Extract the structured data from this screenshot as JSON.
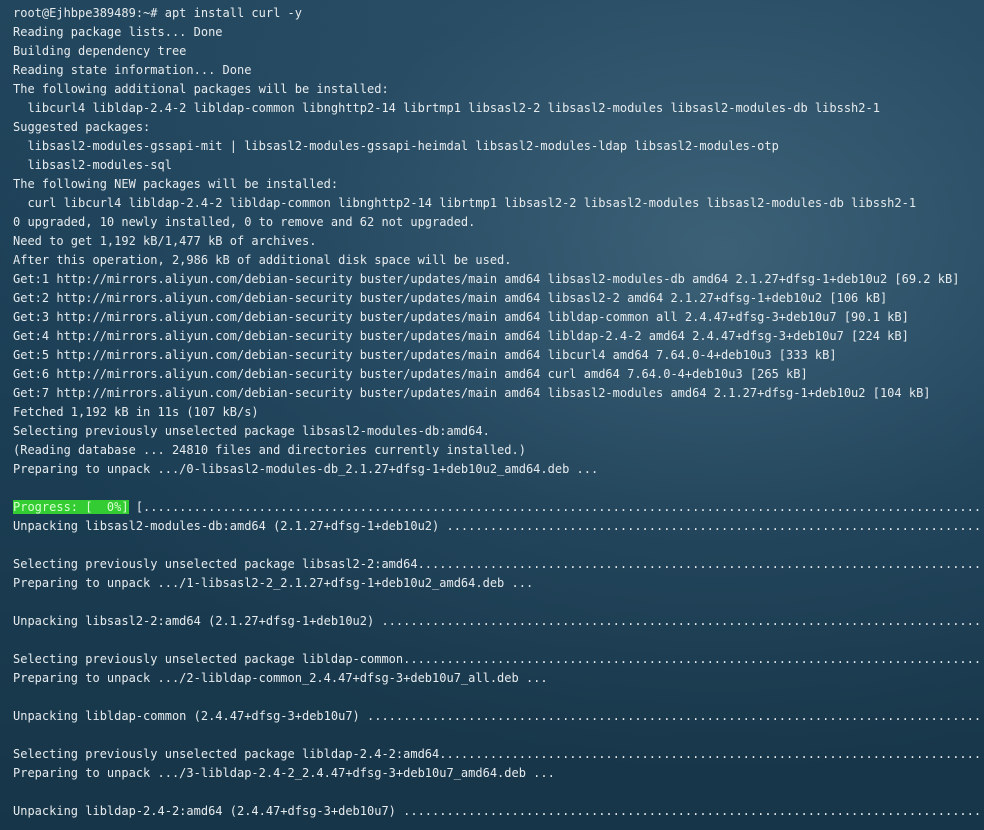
{
  "terminal": {
    "prompt": "root@Ejhbpe389489:~# apt install curl -y",
    "lines": [
      "Reading package lists... Done",
      "Building dependency tree",
      "Reading state information... Done",
      "The following additional packages will be installed:",
      "  libcurl4 libldap-2.4-2 libldap-common libnghttp2-14 librtmp1 libsasl2-2 libsasl2-modules libsasl2-modules-db libssh2-1",
      "Suggested packages:",
      "  libsasl2-modules-gssapi-mit | libsasl2-modules-gssapi-heimdal libsasl2-modules-ldap libsasl2-modules-otp",
      "  libsasl2-modules-sql",
      "The following NEW packages will be installed:",
      "  curl libcurl4 libldap-2.4-2 libldap-common libnghttp2-14 librtmp1 libsasl2-2 libsasl2-modules libsasl2-modules-db libssh2-1",
      "0 upgraded, 10 newly installed, 0 to remove and 62 not upgraded.",
      "Need to get 1,192 kB/1,477 kB of archives.",
      "After this operation, 2,986 kB of additional disk space will be used.",
      "Get:1 http://mirrors.aliyun.com/debian-security buster/updates/main amd64 libsasl2-modules-db amd64 2.1.27+dfsg-1+deb10u2 [69.2 kB]",
      "Get:2 http://mirrors.aliyun.com/debian-security buster/updates/main amd64 libsasl2-2 amd64 2.1.27+dfsg-1+deb10u2 [106 kB]",
      "Get:3 http://mirrors.aliyun.com/debian-security buster/updates/main amd64 libldap-common all 2.4.47+dfsg-3+deb10u7 [90.1 kB]",
      "Get:4 http://mirrors.aliyun.com/debian-security buster/updates/main amd64 libldap-2.4-2 amd64 2.4.47+dfsg-3+deb10u7 [224 kB]",
      "Get:5 http://mirrors.aliyun.com/debian-security buster/updates/main amd64 libcurl4 amd64 7.64.0-4+deb10u3 [333 kB]",
      "Get:6 http://mirrors.aliyun.com/debian-security buster/updates/main amd64 curl amd64 7.64.0-4+deb10u3 [265 kB]",
      "Get:7 http://mirrors.aliyun.com/debian-security buster/updates/main amd64 libsasl2-modules amd64 2.1.27+dfsg-1+deb10u2 [104 kB]",
      "Fetched 1,192 kB in 11s (107 kB/s)",
      "Selecting previously unselected package libsasl2-modules-db:amd64.",
      "(Reading database ... 24810 files and directories currently installed.)",
      "Preparing to unpack .../0-libsasl2-modules-db_2.1.27+dfsg-1+deb10u2_amd64.deb ..."
    ],
    "progress": {
      "label": "Progress: [  0%]",
      "bar": " [..............................................................................................................................................................."
    },
    "lines_after": [
      "Unpacking libsasl2-modules-db:amd64 (2.1.27+dfsg-1+deb10u2) ..................................................................................................",
      "",
      "Selecting previously unselected package libsasl2-2:amd64...................................................................................................",
      "Preparing to unpack .../1-libsasl2-2_2.1.27+dfsg-1+deb10u2_amd64.deb ...",
      "",
      "Unpacking libsasl2-2:amd64 (2.1.27+dfsg-1+deb10u2) ...........................................................................................................",
      "",
      "Selecting previously unselected package libldap-common.....................................................................................................",
      "Preparing to unpack .../2-libldap-common_2.4.47+dfsg-3+deb10u7_all.deb ...",
      "",
      "Unpacking libldap-common (2.4.47+dfsg-3+deb10u7) .............................................................................................................",
      "",
      "Selecting previously unselected package libldap-2.4-2:amd64...............................................................................................",
      "Preparing to unpack .../3-libldap-2.4-2_2.4.47+dfsg-3+deb10u7_amd64.deb ...",
      "",
      "Unpacking libldap-2.4-2:amd64 (2.4.47+dfsg-3+deb10u7) ........................................................................................................"
    ],
    "colors": {
      "text": "#e6ebee",
      "progress_bg": "#33cc33",
      "progress_text": "#d9ffd0",
      "background": "#1d3a4e"
    }
  }
}
